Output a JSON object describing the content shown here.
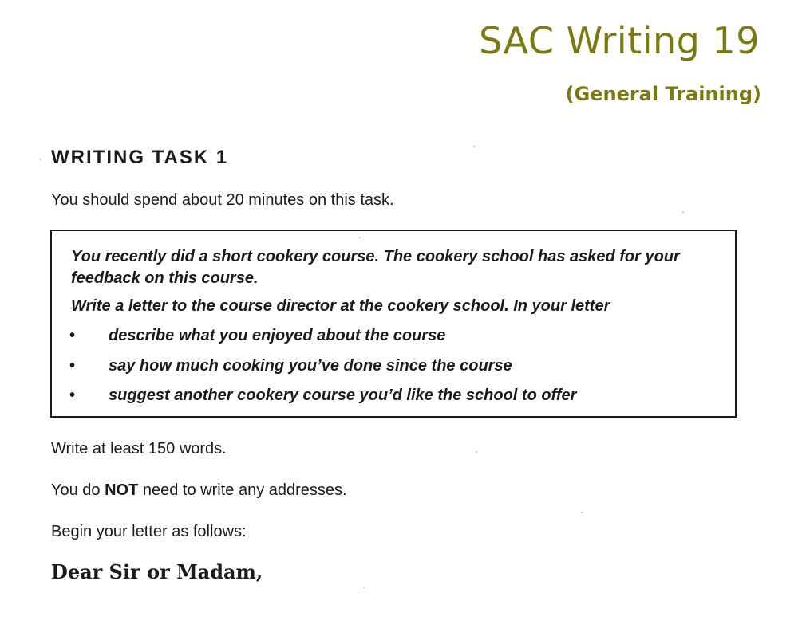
{
  "header": {
    "title": "SAC Writing 19",
    "subtitle": "(General Training)"
  },
  "task": {
    "heading": "WRITING TASK 1",
    "time_instruction": "You should spend about 20 minutes on this task."
  },
  "prompt_box": {
    "intro": "You recently did a short cookery course. The cookery school has asked for your feedback on this course.",
    "instruction": "Write a letter to the course director at the cookery school. In your letter",
    "bullet_symbol": "•",
    "bullets": [
      "describe what you enjoyed about the course",
      "say how much cooking you’ve done since the course",
      "suggest another cookery course you’d like the school to offer"
    ]
  },
  "requirements": {
    "word_count": "Write at least 150 words.",
    "addresses_before": "You do ",
    "addresses_emphasis": "NOT",
    "addresses_after": " need to write any addresses.",
    "begin": "Begin your letter as follows:"
  },
  "letter": {
    "salutation": "Dear Sir or Madam,"
  },
  "colors": {
    "header_olive": "#7a7a10",
    "text": "#1a1a1a",
    "background": "#ffffff"
  }
}
